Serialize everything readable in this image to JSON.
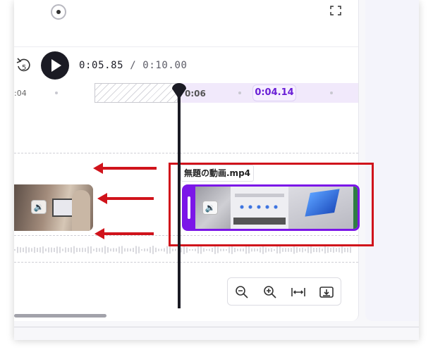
{
  "player": {
    "rewind_seconds": "5",
    "current_time": "0:05.85",
    "separator": "/",
    "total_time": "0:10.00"
  },
  "ruler": {
    "left_tick_label": ":04",
    "range_start_label": "0:06",
    "range_duration_badge": "0:04.14"
  },
  "clips": {
    "selected_clip_name": "無題の動画.mp4",
    "sound_icon": "speaker-icon"
  },
  "colors": {
    "accent": "#7b16e8",
    "annotation": "#d0131b",
    "playhead": "#1b1b24"
  },
  "toolbar": {
    "icons": [
      "zoom-out-icon",
      "zoom-in-icon",
      "fit-width-icon",
      "download-icon"
    ]
  }
}
